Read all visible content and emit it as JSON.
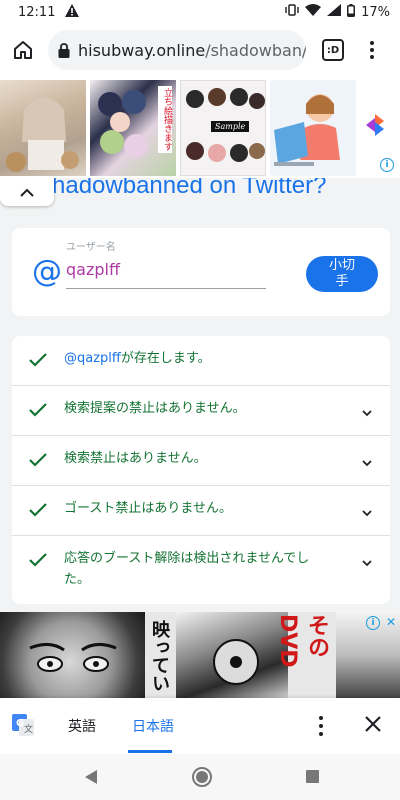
{
  "status_bar": {
    "time": "12:11",
    "battery": "17%",
    "icons": [
      "warning-icon",
      "vibrate-icon",
      "wifi-icon",
      "signal-icon",
      "battery-icon"
    ]
  },
  "browser": {
    "url_host": "hisubway.online",
    "url_path": "/shadowban/",
    "tab_badge": ":D"
  },
  "page": {
    "heading": "hadowbanned on Twitter?",
    "username_label": "ユーザー名",
    "username_value": "qazplff",
    "check_button_line1": "小切",
    "check_button_line2": "手",
    "results": [
      {
        "prefix": "@qazplff",
        "text": "が存在します。",
        "expandable": false
      },
      {
        "prefix": "",
        "text": "検索提案の禁止はありません。",
        "expandable": true
      },
      {
        "prefix": "",
        "text": "検索禁止はありません。",
        "expandable": true
      },
      {
        "prefix": "",
        "text": "ゴースト禁止はありません。",
        "expandable": true
      },
      {
        "prefix": "",
        "text": "応答のブースト解除は検出されませんでした。",
        "expandable": true
      }
    ]
  },
  "ads": {
    "top_sample_label": "Sample",
    "top_vertical_text": "立ち絵描きます",
    "bottom_text_1": "映ってい",
    "bottom_text_2": "そのDVD"
  },
  "translate_bar": {
    "source_lang": "英語",
    "target_lang": "日本語"
  },
  "colors": {
    "accent": "#1a73e8",
    "success": "#137333",
    "username": "#b03aa4",
    "page_bg": "#f1f3f4"
  }
}
